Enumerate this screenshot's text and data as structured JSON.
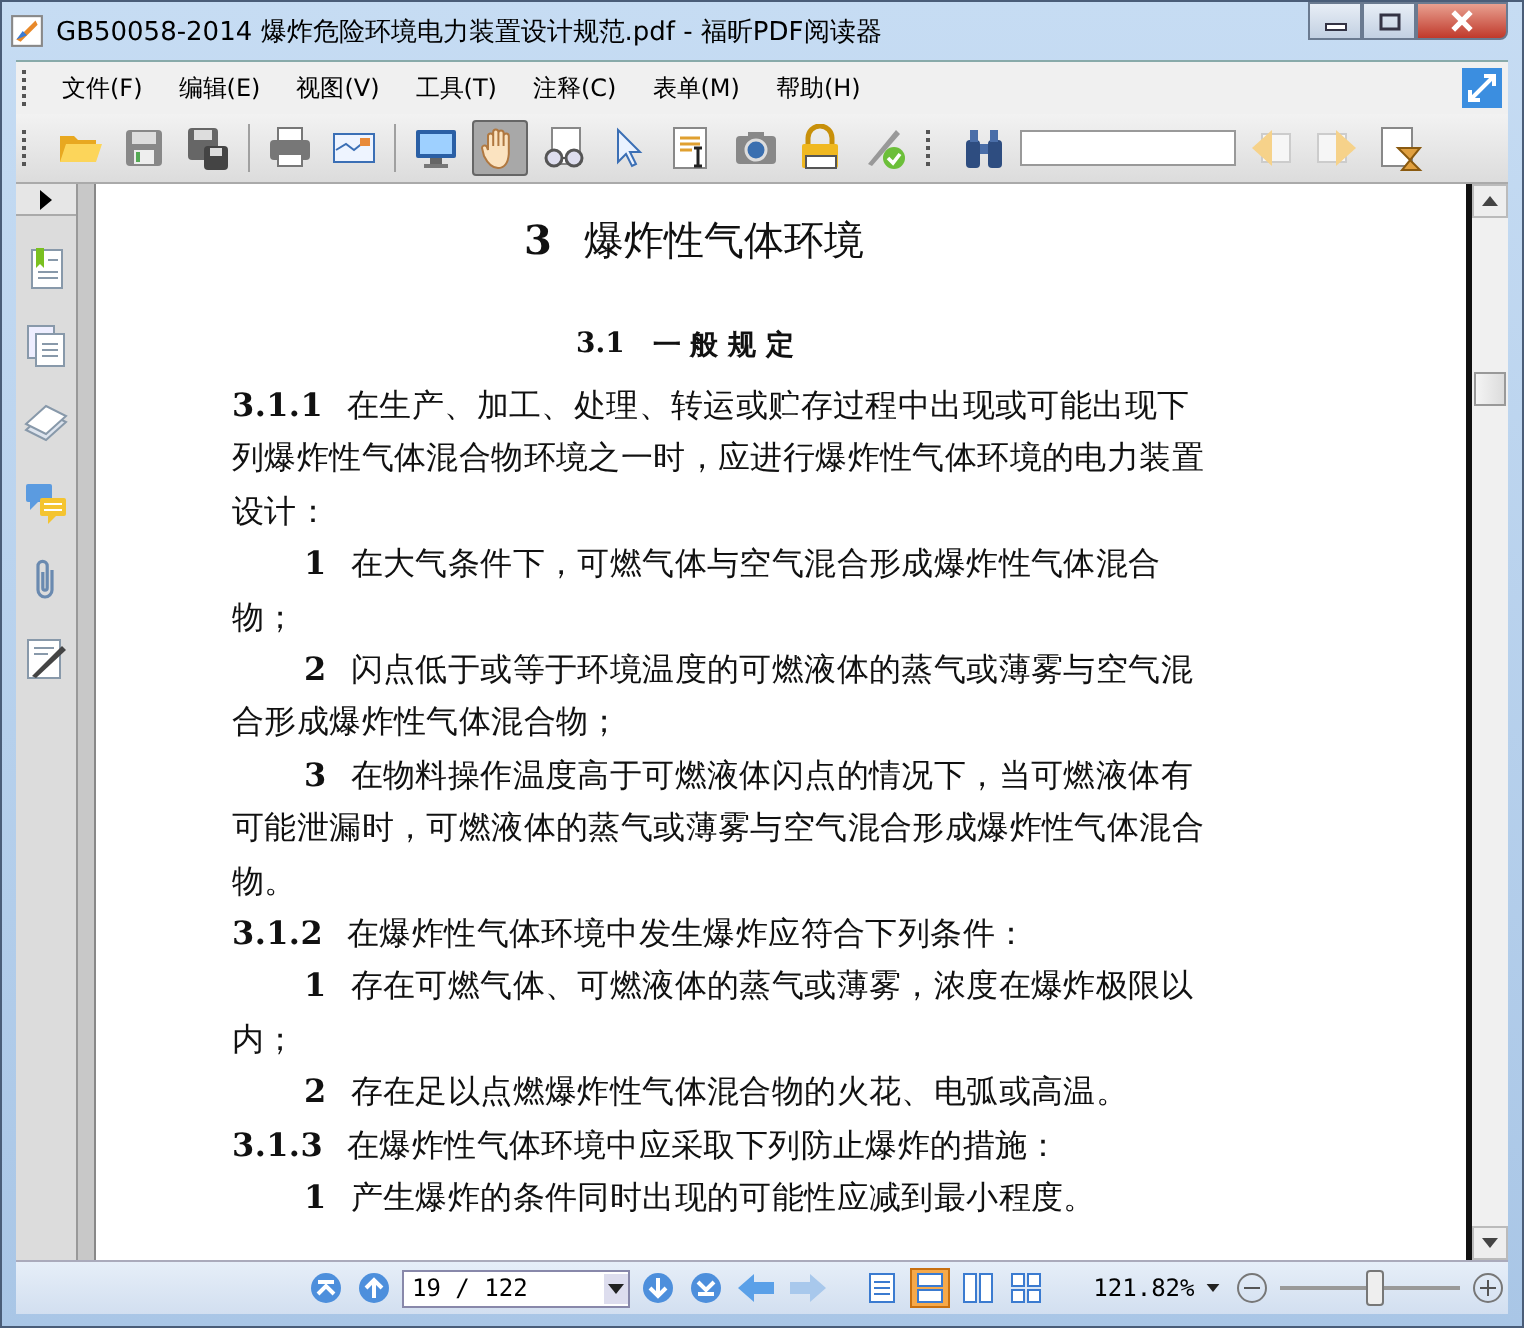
{
  "window": {
    "title": "GB50058-2014 爆炸危险环境电力装置设计规范.pdf - 福昕PDF阅读器"
  },
  "menu": [
    "文件(F)",
    "编辑(E)",
    "视图(V)",
    "工具(T)",
    "注释(C)",
    "表单(M)",
    "帮助(H)"
  ],
  "toolbar": [
    {
      "kind": "open",
      "selected": false
    },
    {
      "kind": "save",
      "selected": false
    },
    {
      "kind": "save-as",
      "selected": false
    },
    {
      "kind": "separator"
    },
    {
      "kind": "print",
      "selected": false
    },
    {
      "kind": "email",
      "selected": false
    },
    {
      "kind": "separator"
    },
    {
      "kind": "monitor",
      "selected": false
    },
    {
      "kind": "hand",
      "selected": true
    },
    {
      "kind": "glasses",
      "selected": false
    },
    {
      "kind": "pointer",
      "selected": false
    },
    {
      "kind": "text-select",
      "selected": false
    },
    {
      "kind": "camera",
      "selected": false
    },
    {
      "kind": "lock",
      "selected": false
    },
    {
      "kind": "sign",
      "selected": false
    },
    {
      "kind": "grip"
    },
    {
      "kind": "binoculars",
      "selected": false
    },
    {
      "kind": "search-field"
    },
    {
      "kind": "prev",
      "selected": false
    },
    {
      "kind": "next",
      "selected": false
    },
    {
      "kind": "timer",
      "selected": false
    }
  ],
  "sidebar": [
    {
      "kind": "bookmark"
    },
    {
      "kind": "pages"
    },
    {
      "kind": "layers"
    },
    {
      "kind": "comments"
    },
    {
      "kind": "attachment"
    },
    {
      "kind": "signature"
    }
  ],
  "document": {
    "chapter_number": "3",
    "chapter_title": "爆炸性气体环境",
    "section_number": "3.1",
    "section_title": "一 般 规 定",
    "paragraphs": [
      {
        "kind": "clause",
        "number": "3.1.1",
        "text": "在生产、加工、处理、转运或贮存过程中出现或可能出现下列爆炸性气体混合物环境之一时，应进行爆炸性气体环境的电力装置设计："
      },
      {
        "kind": "item",
        "number": "1",
        "text": "在大气条件下，可燃气体与空气混合形成爆炸性气体混合物；"
      },
      {
        "kind": "item",
        "number": "2",
        "text": "闪点低于或等于环境温度的可燃液体的蒸气或薄雾与空气混合形成爆炸性气体混合物；"
      },
      {
        "kind": "item",
        "number": "3",
        "text": "在物料操作温度高于可燃液体闪点的情况下，当可燃液体有可能泄漏时，可燃液体的蒸气或薄雾与空气混合形成爆炸性气体混合物。"
      },
      {
        "kind": "clause",
        "number": "3.1.2",
        "text": "在爆炸性气体环境中发生爆炸应符合下列条件："
      },
      {
        "kind": "item",
        "number": "1",
        "text": "存在可燃气体、可燃液体的蒸气或薄雾，浓度在爆炸极限以内；"
      },
      {
        "kind": "item",
        "number": "2",
        "text": "存在足以点燃爆炸性气体混合物的火花、电弧或高温。"
      },
      {
        "kind": "clause",
        "number": "3.1.3",
        "text": "在爆炸性气体环境中应采取下列防止爆炸的措施："
      },
      {
        "kind": "item",
        "number": "1",
        "text": "产生爆炸的条件同时出现的可能性应减到最小程度。"
      }
    ]
  },
  "status_bar": {
    "page": "19 / 122",
    "zoom": "121.82%",
    "zoom_slider": {
      "level": 0.52
    },
    "view_modes": [
      {
        "kind": "single",
        "selected": false
      },
      {
        "kind": "continuous",
        "selected": true
      },
      {
        "kind": "facing",
        "selected": false
      },
      {
        "kind": "continuous-facing",
        "selected": false
      }
    ]
  }
}
